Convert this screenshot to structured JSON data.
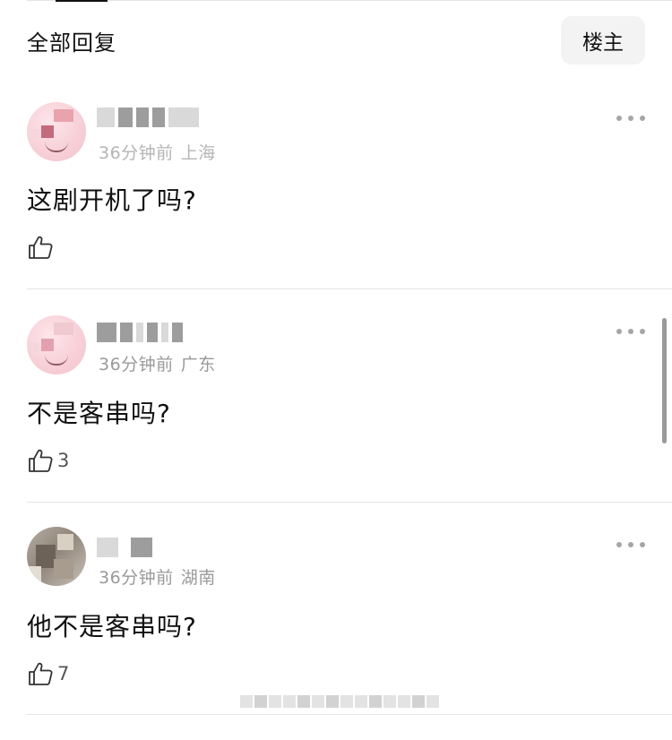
{
  "header": {
    "title": "全部回复",
    "filter_label": "楼主"
  },
  "comments": [
    {
      "time": "36分钟前",
      "location": "上海",
      "content": "这剧开机了吗?",
      "likes": ""
    },
    {
      "time": "36分钟前",
      "location": "广东",
      "content": "不是客串吗?",
      "likes": "3"
    },
    {
      "time": "36分钟前",
      "location": "湖南",
      "content": "他不是客串吗?",
      "likes": "7"
    }
  ],
  "icons": {
    "like": "thumbs-up-icon",
    "more": "more-dots-icon"
  },
  "colors": {
    "text": "#111111",
    "meta": "#9a9a9a",
    "divider": "#e4e4e4",
    "filter_bg": "#f3f3f3"
  }
}
